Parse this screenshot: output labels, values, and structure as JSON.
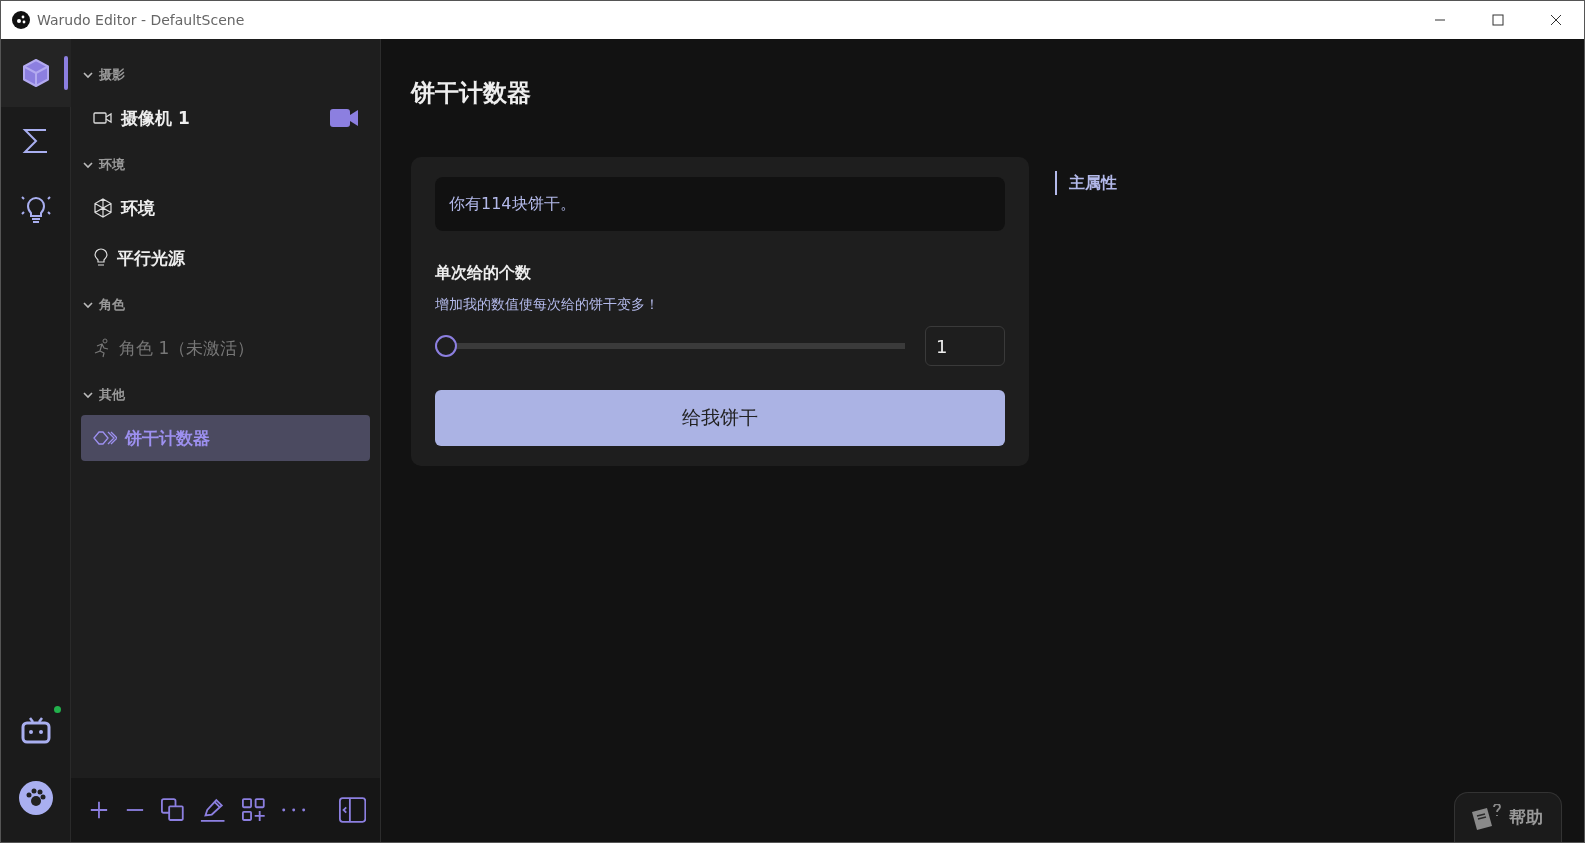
{
  "window": {
    "title": "Warudo Editor - DefaultScene"
  },
  "rail": [
    {
      "kind": "cube",
      "selected": true
    },
    {
      "kind": "sigma",
      "selected": false
    },
    {
      "kind": "bulb",
      "selected": false
    }
  ],
  "rail_bottom": {
    "online": true
  },
  "sidebar": {
    "groups": [
      {
        "label": "摄影",
        "expanded": true,
        "items": [
          {
            "kind": "camera",
            "label": "摄像机 1",
            "live": true,
            "disabled": false,
            "selected": false
          }
        ]
      },
      {
        "label": "环境",
        "expanded": true,
        "items": [
          {
            "kind": "environment",
            "label": "环境",
            "live": false,
            "disabled": false,
            "selected": false
          },
          {
            "kind": "light",
            "label": "平行光源",
            "live": false,
            "disabled": false,
            "selected": false
          }
        ]
      },
      {
        "label": "角色",
        "expanded": true,
        "items": [
          {
            "kind": "character",
            "label": "角色 1（未激活）",
            "live": false,
            "disabled": true,
            "selected": false
          }
        ]
      },
      {
        "label": "其他",
        "expanded": true,
        "items": [
          {
            "kind": "blueprint",
            "label": "饼干计数器",
            "live": false,
            "disabled": false,
            "selected": true
          }
        ]
      }
    ]
  },
  "main": {
    "title": "饼干计数器",
    "message": "你有114块饼干。",
    "field": {
      "label": "单次给的个数",
      "description": "增加我的数值使每次给的饼干变多！",
      "level": 0,
      "value": "1"
    },
    "button": "给我饼干",
    "nav": [
      {
        "label": "主属性",
        "selected": true
      }
    ]
  },
  "help": "帮助"
}
